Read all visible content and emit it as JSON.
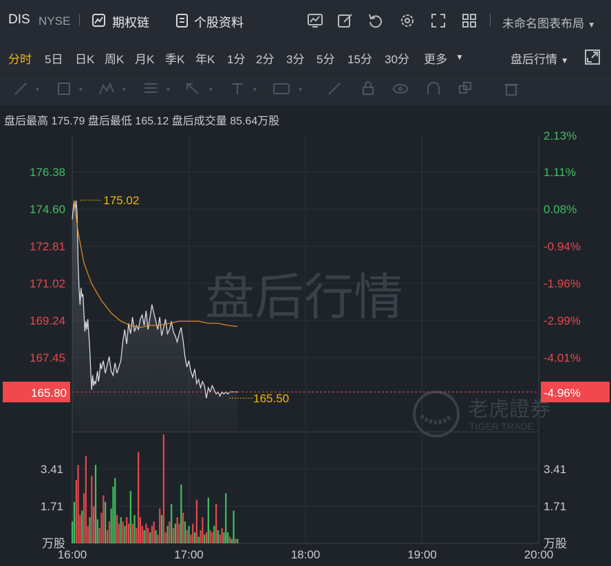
{
  "header": {
    "symbol": "DIS",
    "exchange": "NYSE",
    "options_chain_label": "期权链",
    "profile_label": "个股资料",
    "layout_label": "未命名图表布局"
  },
  "periods": {
    "items": [
      "分时",
      "5日",
      "日K",
      "周K",
      "月K",
      "季K",
      "年K",
      "1分",
      "2分",
      "3分",
      "5分",
      "15分",
      "30分",
      "更多"
    ],
    "active": "分时",
    "mode_label": "盘后行情"
  },
  "info": {
    "high_label": "盘后最高",
    "high_value": "175.79",
    "low_label": "盘后最低",
    "low_value": "165.12",
    "volume_label": "盘后成交量",
    "volume_value": "85.64万股"
  },
  "watermark": "盘后行情",
  "logo": {
    "cn": "老虎證券",
    "en": "TIGER TRADE"
  },
  "colors": {
    "up": "#e5484d",
    "down": "#3fbf5f",
    "price_line": "#d9dbe0",
    "avg_line": "#e08a1e",
    "accent": "#f2b705",
    "current_bg": "#f0484d"
  },
  "chart_data": {
    "type": "line",
    "price_axis_labels": [
      "176.38",
      "174.60",
      "172.81",
      "171.02",
      "169.24",
      "167.45"
    ],
    "percent_axis_labels": [
      "2.13%",
      "1.11%",
      "0.08%",
      "-0.94%",
      "-1.96%",
      "-2.99%",
      "-4.01%"
    ],
    "current_price": "165.80",
    "current_pct": "-4.96%",
    "high_marker": "175.02",
    "low_marker": "165.50",
    "time_labels": [
      "16:00",
      "17:00",
      "18:00",
      "19:00",
      "20:00"
    ],
    "volume_axis_labels": [
      "3.41",
      "1.71"
    ],
    "volume_unit": "万股",
    "ylim": [
      165.12,
      177.4
    ],
    "price_series": {
      "x_min": [
        0,
        0.5,
        1,
        1.5,
        2,
        2.5,
        3,
        3.5,
        4,
        4.5,
        5,
        5.5,
        6,
        6.5,
        7,
        7.5,
        8,
        8.5,
        9,
        9.5,
        10,
        10.5,
        11,
        11.5,
        12,
        12.5,
        13,
        13.5,
        14,
        14.5,
        15,
        16,
        17,
        18,
        19,
        20,
        21,
        22,
        23,
        24,
        25,
        26,
        27,
        28,
        29,
        30,
        31,
        32,
        33,
        34,
        35,
        36,
        37,
        38,
        39,
        40,
        41,
        42,
        43,
        44,
        45,
        46,
        47,
        48,
        49,
        50,
        51,
        52,
        53,
        54,
        55,
        56,
        57,
        58,
        59,
        60,
        61,
        62,
        63,
        64,
        65,
        66,
        67,
        68,
        69,
        70,
        71,
        72,
        73,
        74,
        75,
        76,
        77,
        78,
        79,
        80,
        81,
        82,
        83,
        84,
        85
      ],
      "values": [
        174.1,
        174.6,
        175.0,
        174.5,
        175.0,
        174.4,
        172.0,
        170.8,
        170.0,
        170.8,
        170.4,
        170.5,
        169.6,
        168.7,
        169.2,
        168.8,
        169.3,
        168.6,
        167.9,
        166.8,
        165.9,
        166.6,
        166.1,
        166.3,
        166.2,
        166.5,
        166.8,
        166.3,
        166.6,
        167.2,
        166.9,
        167.3,
        166.7,
        167.1,
        167.5,
        166.8,
        166.6,
        167.2,
        166.7,
        167.0,
        167.3,
        168.2,
        168.8,
        168.1,
        169.1,
        168.6,
        169.4,
        168.7,
        169.0,
        168.8,
        169.3,
        169.5,
        169.0,
        169.7,
        168.8,
        169.4,
        170.0,
        169.6,
        169.2,
        168.8,
        169.4,
        168.5,
        168.9,
        169.3,
        168.6,
        168.8,
        169.2,
        168.7,
        168.5,
        168.2,
        168.6,
        168.9,
        168.3,
        167.5,
        167.0,
        167.3,
        166.8,
        166.5,
        166.9,
        166.2,
        166.4,
        166.0,
        166.3,
        166.1,
        165.5,
        166.0,
        165.8,
        166.1,
        165.9,
        165.7,
        165.8,
        165.6,
        165.8,
        165.7,
        165.8,
        165.7,
        165.8,
        165.8,
        165.8,
        165.8,
        165.8,
        165.8
      ],
      "x_max_points": 101
    },
    "avg_series": {
      "x_min": [
        1,
        3,
        6,
        10,
        15,
        20,
        25,
        30,
        35,
        40,
        45,
        50,
        55,
        60,
        65,
        70,
        75,
        80,
        85
      ],
      "values": [
        175.0,
        173.5,
        172.0,
        171.0,
        170.2,
        169.6,
        169.2,
        169.0,
        168.9,
        169.0,
        169.0,
        169.1,
        169.2,
        169.2,
        169.2,
        169.1,
        169.1,
        169.0,
        168.95
      ]
    },
    "x_range_min": [
      0,
      240
    ],
    "volume": {
      "max": 5.12,
      "bars": [
        [
          0,
          1.0,
          "down"
        ],
        [
          1,
          1.9,
          "down"
        ],
        [
          2,
          2.9,
          "up"
        ],
        [
          3,
          3.6,
          "up"
        ],
        [
          4,
          1.3,
          "up"
        ],
        [
          5,
          1.5,
          "down"
        ],
        [
          6,
          2.3,
          "up"
        ],
        [
          7,
          4.0,
          "up"
        ],
        [
          8,
          0.8,
          "up"
        ],
        [
          9,
          1.2,
          "down"
        ],
        [
          10,
          3.1,
          "up"
        ],
        [
          11,
          1.7,
          "up"
        ],
        [
          12,
          2.6,
          "up"
        ],
        [
          13,
          1.1,
          "down"
        ],
        [
          14,
          0.7,
          "up"
        ],
        [
          15,
          1.4,
          "up"
        ],
        [
          16,
          2.2,
          "up"
        ],
        [
          17,
          1.9,
          "down"
        ],
        [
          18,
          0.6,
          "up"
        ],
        [
          19,
          1.0,
          "up"
        ],
        [
          20,
          1.6,
          "down"
        ],
        [
          21,
          2.6,
          "down"
        ],
        [
          22,
          3.0,
          "down"
        ],
        [
          23,
          1.3,
          "up"
        ],
        [
          24,
          0.9,
          "up"
        ],
        [
          25,
          1.2,
          "down"
        ],
        [
          26,
          1.0,
          "up"
        ],
        [
          27,
          0.8,
          "down"
        ],
        [
          28,
          1.2,
          "up"
        ],
        [
          29,
          0.9,
          "up"
        ],
        [
          30,
          2.4,
          "down"
        ],
        [
          31,
          0.9,
          "up"
        ],
        [
          32,
          1.3,
          "down"
        ],
        [
          33,
          0.7,
          "up"
        ],
        [
          34,
          1.1,
          "down"
        ],
        [
          35,
          1.2,
          "up"
        ],
        [
          36,
          0.8,
          "up"
        ],
        [
          37,
          0.6,
          "down"
        ],
        [
          38,
          0.9,
          "up"
        ],
        [
          39,
          0.7,
          "up"
        ],
        [
          40,
          0.5,
          "down"
        ],
        [
          41,
          0.8,
          "up"
        ],
        [
          42,
          1.0,
          "up"
        ],
        [
          43,
          0.6,
          "down"
        ],
        [
          44,
          0.4,
          "up"
        ],
        [
          45,
          1.6,
          "up"
        ],
        [
          46,
          1.3,
          "down"
        ],
        [
          47,
          1.1,
          "up"
        ],
        [
          48,
          0.5,
          "up"
        ],
        [
          49,
          0.8,
          "down"
        ],
        [
          50,
          1.0,
          "up"
        ],
        [
          51,
          1.8,
          "down"
        ],
        [
          52,
          0.7,
          "up"
        ],
        [
          53,
          0.9,
          "down"
        ],
        [
          54,
          1.2,
          "up"
        ],
        [
          55,
          0.9,
          "up"
        ],
        [
          56,
          1.6,
          "down"
        ],
        [
          57,
          1.4,
          "up"
        ],
        [
          58,
          1.0,
          "down"
        ],
        [
          59,
          0.6,
          "up"
        ],
        [
          60,
          0.8,
          "down"
        ],
        [
          61,
          0.4,
          "up"
        ],
        [
          62,
          0.9,
          "up"
        ],
        [
          63,
          0.5,
          "down"
        ],
        [
          64,
          0.7,
          "up"
        ],
        [
          65,
          0.3,
          "down"
        ],
        [
          66,
          0.6,
          "up"
        ],
        [
          67,
          1.2,
          "up"
        ],
        [
          68,
          0.4,
          "down"
        ],
        [
          69,
          0.5,
          "up"
        ],
        [
          70,
          0.9,
          "down"
        ],
        [
          71,
          0.6,
          "up"
        ],
        [
          72,
          0.5,
          "up"
        ],
        [
          73,
          0.8,
          "down"
        ],
        [
          74,
          1.0,
          "up"
        ],
        [
          75,
          0.6,
          "down"
        ],
        [
          76,
          0.4,
          "up"
        ],
        [
          77,
          0.7,
          "up"
        ],
        [
          78,
          0.5,
          "down"
        ],
        [
          79,
          0.4,
          "up"
        ],
        [
          80,
          0.5,
          "down"
        ],
        [
          81,
          0.3,
          "up"
        ],
        [
          82,
          0.2,
          "down"
        ],
        [
          83,
          0.3,
          "up"
        ],
        [
          84,
          0.2,
          "up"
        ],
        [
          85,
          0.2,
          "down"
        ],
        [
          34,
          4.2,
          "up"
        ],
        [
          12,
          3.6,
          "down"
        ],
        [
          47,
          5.0,
          "up"
        ],
        [
          56,
          2.7,
          "down"
        ],
        [
          64,
          2.0,
          "up"
        ],
        [
          70,
          2.1,
          "down"
        ],
        [
          74,
          1.8,
          "up"
        ],
        [
          79,
          2.3,
          "down"
        ],
        [
          83,
          1.5,
          "down"
        ]
      ]
    }
  }
}
